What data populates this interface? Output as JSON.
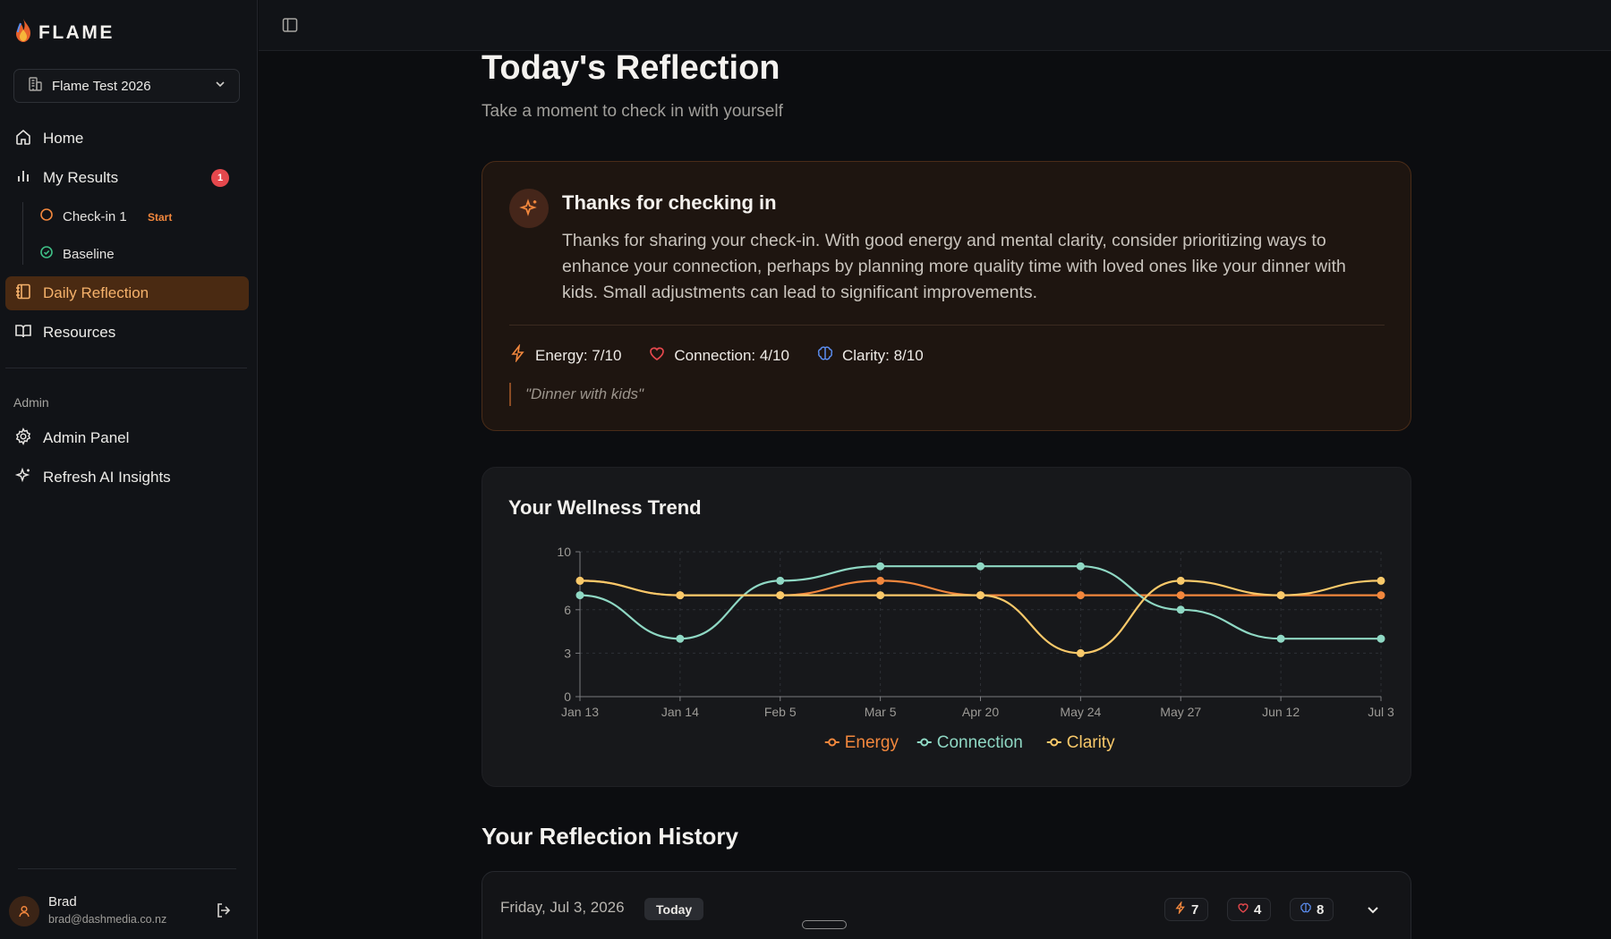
{
  "app": {
    "name": "FLAME"
  },
  "sidebar": {
    "org": "Flame Test 2026",
    "nav": {
      "home": "Home",
      "results": "My Results",
      "results_badge": "1",
      "checkin": "Check-in 1",
      "checkin_tag": "Start",
      "baseline": "Baseline",
      "reflection": "Daily Reflection",
      "resources": "Resources"
    },
    "admin_label": "Admin",
    "admin_panel": "Admin Panel",
    "refresh": "Refresh AI Insights",
    "user": {
      "name": "Brad",
      "email": "brad@dashmedia.co.nz"
    }
  },
  "page": {
    "title": "Today's Reflection",
    "subtitle": "Take a moment to check in with yourself"
  },
  "insight": {
    "title": "Thanks for checking in",
    "body": "Thanks for sharing your check-in. With good energy and mental clarity, consider prioritizing ways to enhance your connection, perhaps by planning more quality time with loved ones like your dinner with kids. Small adjustments can lead to significant improvements.",
    "energy": "Energy: 7/10",
    "connection": "Connection: 4/10",
    "clarity": "Clarity: 8/10",
    "note": "\"Dinner with kids\""
  },
  "colors": {
    "accent": "#f6b26b",
    "energy": "#f2873d",
    "connection": "#8fd8c4",
    "clarity": "#f9c96a",
    "heart": "#e5484d",
    "brain": "#5b8def"
  },
  "chart_data": {
    "type": "line",
    "title": "Your Wellness Trend",
    "categories": [
      "Jan 13",
      "Jan 14",
      "Feb 5",
      "Mar 5",
      "Apr 20",
      "May 24",
      "May 27",
      "Jun 12",
      "Jul 3"
    ],
    "yticks": [
      0,
      3,
      6,
      10
    ],
    "ylim": [
      0,
      10
    ],
    "series": [
      {
        "name": "Energy",
        "color": "#f2873d",
        "values": [
          8,
          7,
          7,
          8,
          7,
          7,
          7,
          7,
          7
        ]
      },
      {
        "name": "Connection",
        "color": "#8fd8c4",
        "values": [
          7,
          4,
          8,
          9,
          9,
          9,
          6,
          4,
          4
        ]
      },
      {
        "name": "Clarity",
        "color": "#f9c96a",
        "values": [
          8,
          7,
          7,
          7,
          7,
          3,
          8,
          7,
          8
        ]
      }
    ],
    "grid": true,
    "legend": "bottom"
  },
  "history": {
    "title": "Your Reflection History",
    "date": "Friday, Jul 3, 2026",
    "tag": "Today",
    "energy": "7",
    "connection": "4",
    "clarity": "8"
  }
}
